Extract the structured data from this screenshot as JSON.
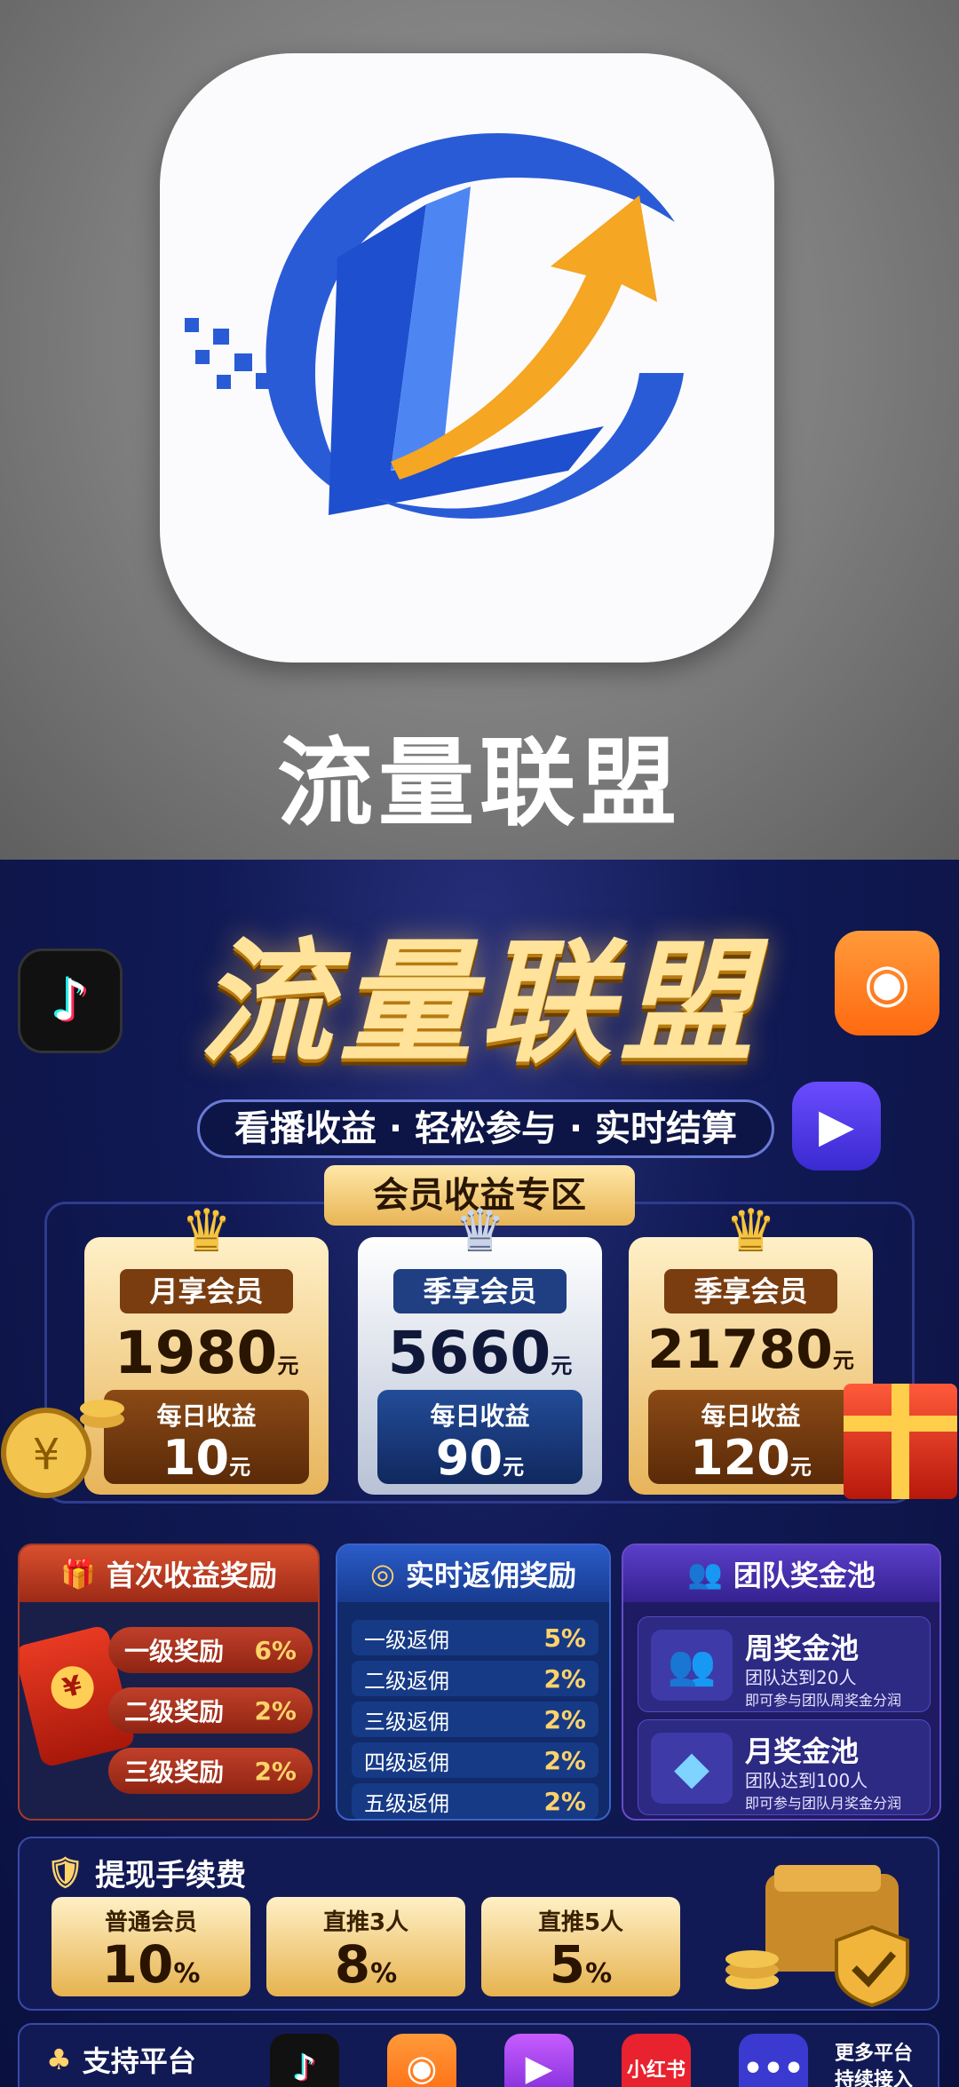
{
  "app": {
    "name": "流量联盟"
  },
  "poster": {
    "title": "流量联盟",
    "slogan": "看播收益 · 轻松参与 · 实时结算",
    "zone_title": "会员收益专区",
    "memberships": [
      {
        "label": "月享会员",
        "price": "1980",
        "unit": "元",
        "daily_label": "每日收益",
        "daily": "10",
        "daily_unit": "元"
      },
      {
        "label": "季享会员",
        "price": "5660",
        "unit": "元",
        "daily_label": "每日收益",
        "daily": "90",
        "daily_unit": "元"
      },
      {
        "label": "季享会员",
        "price": "21780",
        "unit": "元",
        "daily_label": "每日收益",
        "daily": "120",
        "daily_unit": "元"
      }
    ],
    "first_reward": {
      "title": "首次收益奖励",
      "rows": [
        {
          "label": "一级奖励",
          "value": "6%"
        },
        {
          "label": "二级奖励",
          "value": "2%"
        },
        {
          "label": "三级奖励",
          "value": "2%"
        }
      ]
    },
    "commission": {
      "title": "实时返佣奖励",
      "rows": [
        {
          "label": "一级返佣",
          "value": "5%"
        },
        {
          "label": "二级返佣",
          "value": "2%"
        },
        {
          "label": "三级返佣",
          "value": "2%"
        },
        {
          "label": "四级返佣",
          "value": "2%"
        },
        {
          "label": "五级返佣",
          "value": "2%"
        }
      ]
    },
    "team_pool": {
      "title": "团队奖金池",
      "pools": [
        {
          "name": "周奖金池",
          "line1": "团队达到20人",
          "line2": "即可参与团队周奖金分润"
        },
        {
          "name": "月奖金池",
          "line1": "团队达到100人",
          "line2": "即可参与团队月奖金分润"
        }
      ]
    },
    "fees": {
      "title": "提现手续费",
      "items": [
        {
          "label": "普通会员",
          "value": "10",
          "unit": "%"
        },
        {
          "label": "直推3人",
          "value": "8",
          "unit": "%"
        },
        {
          "label": "直推5人",
          "value": "5",
          "unit": "%"
        }
      ]
    },
    "platforms": {
      "title": "支持平台",
      "xiaohongshu": "小红书",
      "more_line1": "更多平台",
      "more_line2": "持续接入"
    }
  },
  "colors": {
    "blue": "#2a5bd7",
    "orange": "#f5a623",
    "gold": "#e8b455",
    "navy": "#0b1238"
  }
}
